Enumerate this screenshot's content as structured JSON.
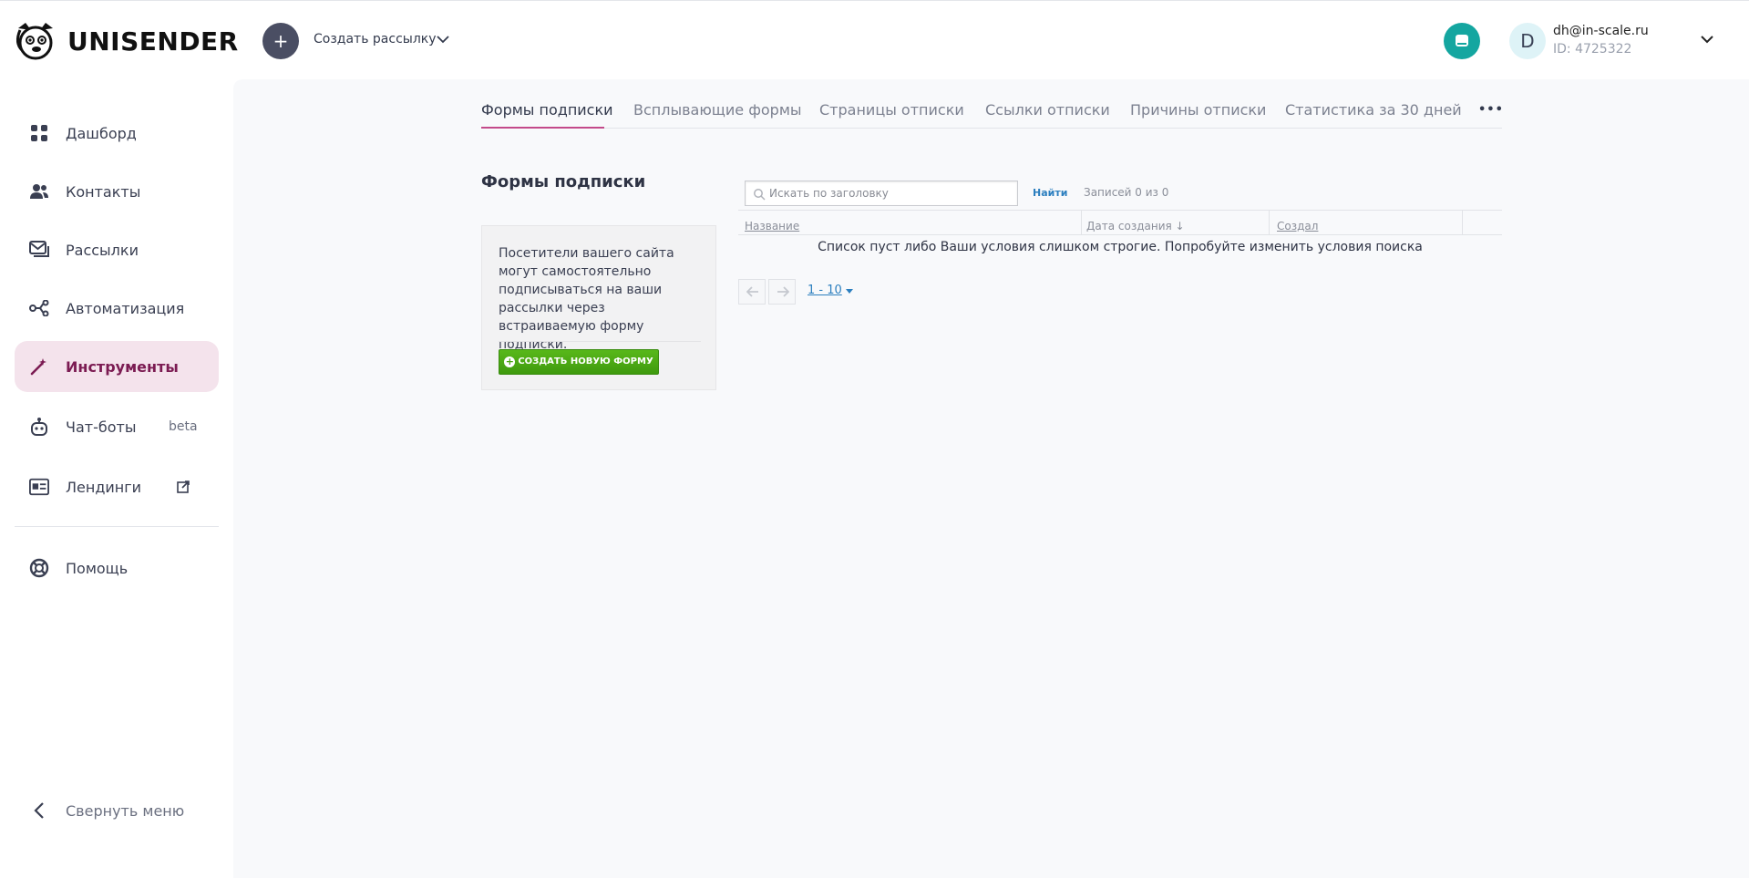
{
  "header": {
    "logo_text": "UNISENDER",
    "create_button_icon": "+",
    "create_label": "Создать рассылку",
    "account_initial": "D",
    "account_email": "dh@in-scale.ru",
    "account_id": "ID: 4725322"
  },
  "sidebar": {
    "items": [
      {
        "label": "Дашборд",
        "icon": "dashboard-icon"
      },
      {
        "label": "Контакты",
        "icon": "contacts-icon"
      },
      {
        "label": "Рассылки",
        "icon": "mailings-icon"
      },
      {
        "label": "Автоматизация",
        "icon": "automation-icon"
      },
      {
        "label": "Инструменты",
        "icon": "tools-wand-icon",
        "active": true
      },
      {
        "label": "Чат-боты",
        "icon": "chatbot-icon",
        "badge": "beta"
      },
      {
        "label": "Лендинги",
        "icon": "landing-icon"
      },
      {
        "label": "Помощь",
        "icon": "help-lifebuoy-icon"
      }
    ],
    "collapse_label": "Свернуть меню"
  },
  "tabs": [
    {
      "label": "Формы подписки",
      "active": true
    },
    {
      "label": "Всплывающие формы"
    },
    {
      "label": "Страницы отписки"
    },
    {
      "label": "Ссылки отписки"
    },
    {
      "label": "Причины отписки"
    },
    {
      "label": "Статистика за 30 дней"
    }
  ],
  "tabs_more": "•••",
  "main": {
    "section_title": "Формы подписки",
    "info_text": "Посетители вашего сайта могут самостоятельно подписываться на ваши рассылки через встраиваемую форму подписки.",
    "new_form_button": "СОЗДАТЬ НОВУЮ ФОРМУ",
    "search_placeholder": "Искать по заголовку",
    "find_label": "Найти",
    "records_label": "Записей 0 из 0",
    "columns": [
      "Название",
      "Дата создания ↓",
      "Создал"
    ],
    "empty_message": "Список пуст либо Ваши условия слишком строгие. Попробуйте изменить условия поиска",
    "pager_range": "1 - 10"
  },
  "colors": {
    "accent": "#7b1b52",
    "active_bg": "#f4e3ec",
    "help_button": "#14a6a0",
    "create_button": "#4a4e63",
    "green_button": "#4aa814",
    "link": "#2c7fbf"
  }
}
